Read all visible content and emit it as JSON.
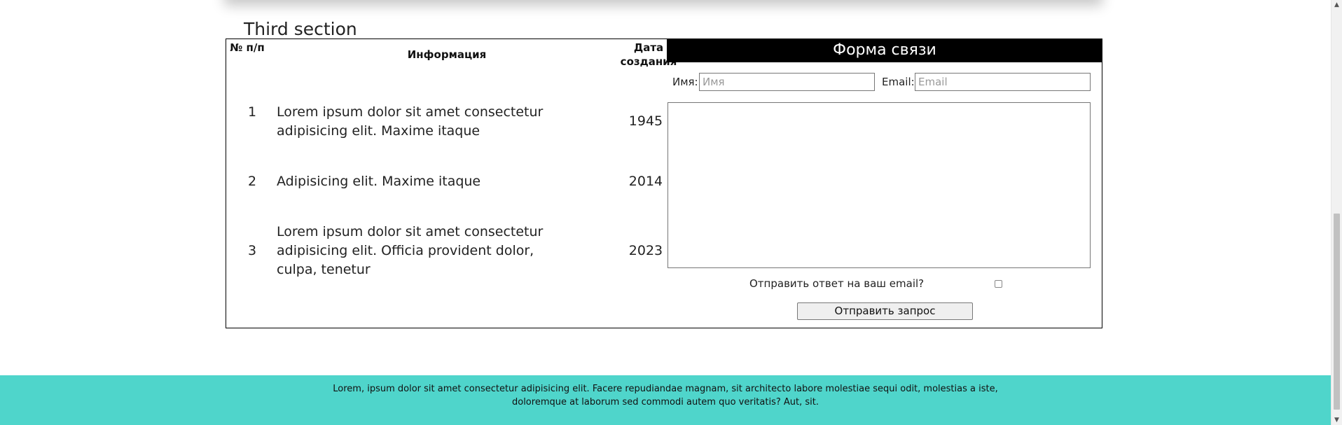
{
  "section": {
    "title": "Third section"
  },
  "table": {
    "headers": {
      "num": "№ п/п",
      "info": "Информация",
      "date": "Дата создания"
    },
    "rows": [
      {
        "num": "1",
        "info": "Lorem ipsum dolor sit amet consectetur adipisicing elit. Maxime itaque",
        "date": "1945 г"
      },
      {
        "num": "2",
        "info": "Adipisicing elit. Maxime itaque",
        "date": "2014 г"
      },
      {
        "num": "3",
        "info": "Lorem ipsum dolor sit amet consectetur adipisicing elit. Officia provident dolor, culpa, tenetur",
        "date": "2023 г"
      }
    ]
  },
  "form": {
    "title": "Форма связи",
    "name_label": "Имя:",
    "name_placeholder": "Имя",
    "email_label": "Email:",
    "email_placeholder": "Email",
    "message_value": "",
    "reply_label": "Отправить ответ на ваш email?",
    "reply_checked": false,
    "submit_label": "Отправить запрос"
  },
  "footer": {
    "text": "Lorem, ipsum dolor sit amet consectetur adipisicing elit. Facere repudiandae magnam, sit architecto labore molestiae sequi odit, molestias a iste, doloremque at laborum sed commodi autem quo veritatis? Aut, sit."
  },
  "colors": {
    "footer_bg": "#4fd5cb",
    "form_header_bg": "#000000"
  },
  "icons": {
    "scroll_up": "chevron-up-icon",
    "scroll_down": "chevron-down-icon"
  }
}
